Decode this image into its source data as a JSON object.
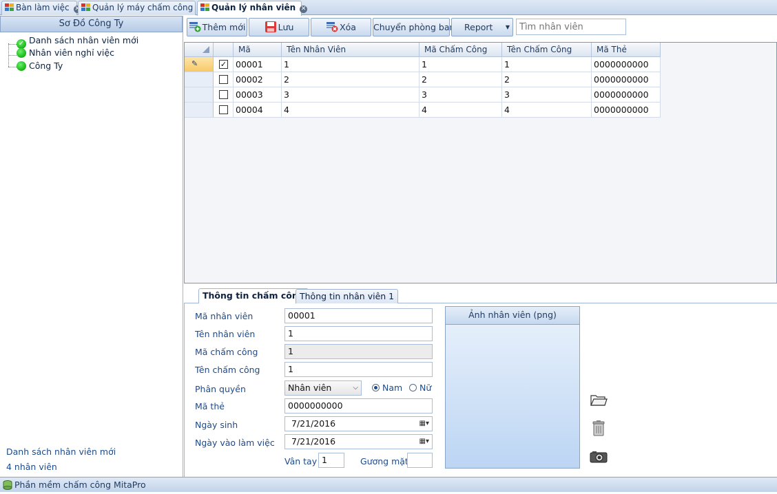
{
  "doc_tabs": [
    {
      "label": "Bàn làm việc",
      "active": false
    },
    {
      "label": "Quản lý máy chấm công",
      "active": false
    },
    {
      "label": "Quản lý nhân viên",
      "active": true
    }
  ],
  "sidebar": {
    "header": "Sơ Đồ Công Ty",
    "items": [
      {
        "label": "Danh sách nhân viên mới",
        "icon": "green-check-circle-icon"
      },
      {
        "label": "Nhân viên nghỉ việc",
        "icon": "green-circle-icon"
      },
      {
        "label": "Công Ty",
        "icon": "green-circle-icon"
      }
    ],
    "footer_title": "Danh sách nhân viên mới",
    "footer_count": "4 nhân viên"
  },
  "toolbar": {
    "add_label": "Thêm mới",
    "save_label": "Lưu",
    "delete_label": "Xóa",
    "transfer_label": "Chuyển phòng ban",
    "report_label": "Report",
    "search_placeholder": "Tìm nhân viên"
  },
  "grid": {
    "columns": [
      "Mã",
      "Tên Nhân Viên",
      "Mã Chấm Công",
      "Tên Chấm Công",
      "Mã Thẻ"
    ],
    "rows": [
      {
        "checked": true,
        "selected": true,
        "cells": [
          "00001",
          "1",
          "1",
          "1",
          "0000000000"
        ]
      },
      {
        "checked": false,
        "selected": false,
        "cells": [
          "00002",
          "2",
          "2",
          "2",
          "0000000000"
        ]
      },
      {
        "checked": false,
        "selected": false,
        "cells": [
          "00003",
          "3",
          "3",
          "3",
          "0000000000"
        ]
      },
      {
        "checked": false,
        "selected": false,
        "cells": [
          "00004",
          "4",
          "4",
          "4",
          "0000000000"
        ]
      }
    ]
  },
  "form": {
    "tabs": [
      {
        "label": "Thông tin chấm công",
        "active": true
      },
      {
        "label": "Thông tin nhân viên 1",
        "active": false
      }
    ],
    "labels": {
      "ma_nv": "Mã nhân viên",
      "ten_nv": "Tên nhân viên",
      "ma_cc": "Mã chấm công",
      "ten_cc": "Tên chấm công",
      "phan_quyen": "Phân quyền",
      "ma_the": "Mã thẻ",
      "ngay_sinh": "Ngày sinh",
      "ngay_vao": "Ngày vào làm việc",
      "van_tay": "Vân tay",
      "guong_mat": "Gương mặt"
    },
    "values": {
      "ma_nv": "00001",
      "ten_nv": "1",
      "ma_cc": "1",
      "ten_cc": "1",
      "phan_quyen": "Nhân viên",
      "ma_the": "0000000000",
      "ngay_sinh": "7/21/2016",
      "ngay_vao": "7/21/2016",
      "van_tay": "1",
      "guong_mat": ""
    },
    "gender": {
      "male_label": "Nam",
      "female_label": "Nữ",
      "selected": "Nam"
    },
    "photo_title": "Ảnh nhân viên (png)"
  },
  "statusbar": {
    "text": "Phần mềm chấm công MitaPro"
  }
}
